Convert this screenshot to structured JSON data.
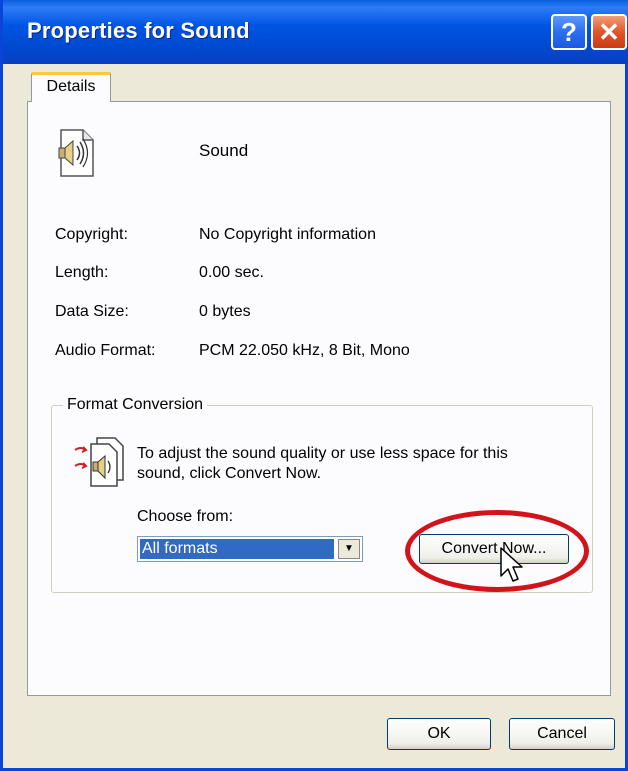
{
  "window": {
    "title": "Properties for Sound",
    "help_glyph": "?",
    "close_glyph": "✕"
  },
  "tabs": [
    {
      "label": "Details"
    }
  ],
  "details": {
    "name": "Sound",
    "rows": [
      {
        "label": "Copyright:",
        "value": "No Copyright information"
      },
      {
        "label": "Length:",
        "value": "0.00 sec."
      },
      {
        "label": "Data Size:",
        "value": "0 bytes"
      },
      {
        "label": "Audio Format:",
        "value": "PCM 22.050 kHz, 8 Bit, Mono"
      }
    ]
  },
  "format_conversion": {
    "legend": "Format Conversion",
    "description": "To adjust the sound quality or use less space for this sound, click Convert Now.",
    "choose_label": "Choose from:",
    "select_value": "All formats",
    "convert_button": "Convert Now..."
  },
  "footer": {
    "ok_label": "OK",
    "cancel_label": "Cancel"
  },
  "colors": {
    "titlebar": "#0054e3",
    "highlight_ring": "#d0141a",
    "selection": "#316ac5"
  },
  "icons": {
    "file": "sound-file-icon",
    "convert": "sound-convert-icon",
    "help": "help-icon",
    "close": "close-icon",
    "dropdown": "chevron-down-icon",
    "cursor": "mouse-pointer-icon"
  }
}
